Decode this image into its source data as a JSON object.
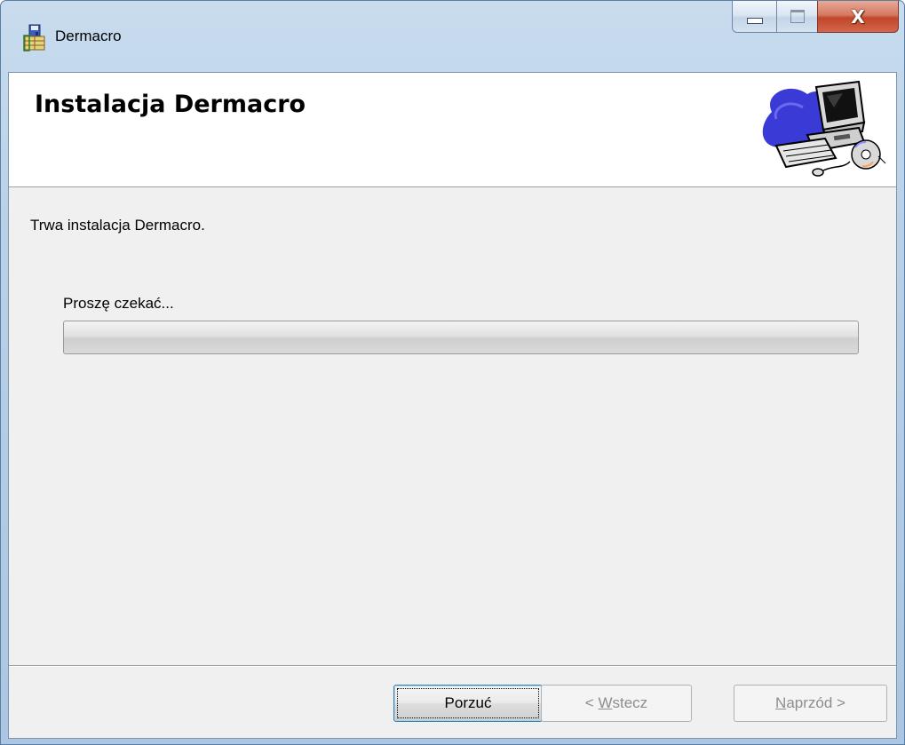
{
  "window": {
    "title": "Dermacro",
    "minimize_icon": "minimize-icon",
    "maximize_icon": "maximize-icon",
    "close_glyph": "X"
  },
  "banner": {
    "title": "Instalacja Dermacro",
    "art_icon": "computer-setup-icon"
  },
  "body": {
    "status": "Trwa instalacja Dermacro.",
    "wait_label": "Proszę czekać...",
    "progress_fraction": 0
  },
  "buttons": {
    "cancel_label": "Porzuć",
    "back_prefix": "< ",
    "back_mnemonic": "W",
    "back_rest": "stecz",
    "next_mnemonic": "N",
    "next_rest": "aprzód >"
  },
  "colors": {
    "titlebar": "#b9d1e8",
    "close_button": "#c2462a",
    "client_bg": "#f0f0f0",
    "banner_bg": "#ffffff",
    "progress_fill": "#37b52c"
  }
}
